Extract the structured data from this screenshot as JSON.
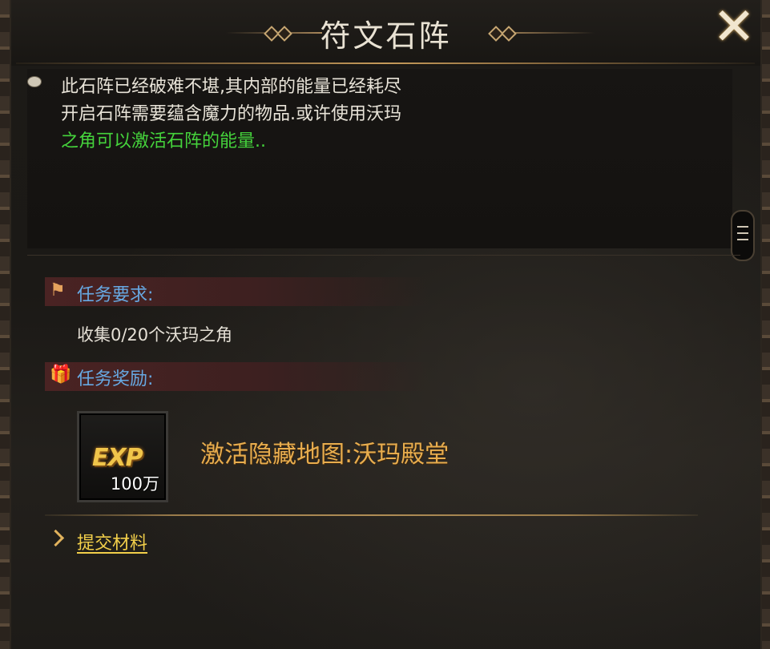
{
  "window": {
    "title": "符文石阵",
    "close_icon": "close-x-icon"
  },
  "description": {
    "icon": "speech-bubble-icon",
    "lines": [
      "此石阵已经破难不堪,其内部的能量已经耗尽",
      "开启石阵需要蕴含魔力的物品.或许使用沃玛"
    ],
    "highlight_line": "之角可以激活石阵的能量..",
    "highlight_color": "#45d33c"
  },
  "requirement": {
    "icon": "quest-flag-icon",
    "title": "任务要求:",
    "text": "收集0/20个沃玛之角"
  },
  "reward": {
    "icon": "gift-box-icon",
    "title": "任务奖励:",
    "item_icon_text": "EXP",
    "item_count": "100万",
    "text": "激活隐藏地图:沃玛殿堂"
  },
  "action": {
    "icon": "chevron-right-icon",
    "label": "提交材料"
  },
  "colors": {
    "section_title": "#67a9e3",
    "reward_text": "#e8ad4e",
    "link": "#f2cf4a"
  }
}
